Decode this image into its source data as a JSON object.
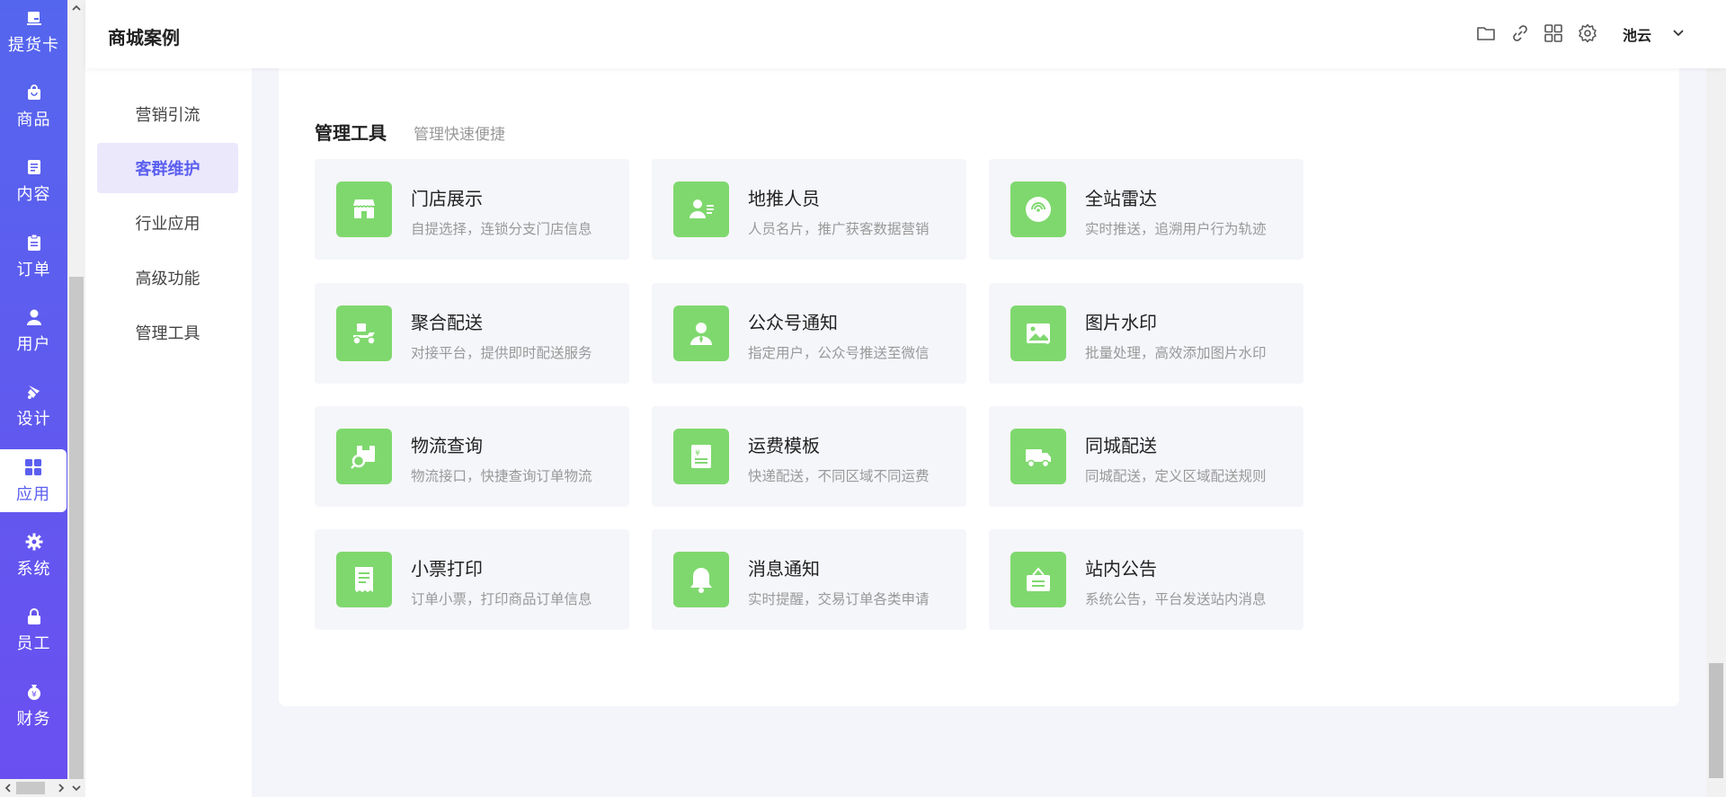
{
  "nav": {
    "items": [
      {
        "label": "提货卡",
        "icon": "card-icon"
      },
      {
        "label": "商品",
        "icon": "bag-icon"
      },
      {
        "label": "内容",
        "icon": "document-icon"
      },
      {
        "label": "订单",
        "icon": "clipboard-icon"
      },
      {
        "label": "用户",
        "icon": "user-icon"
      },
      {
        "label": "设计",
        "icon": "brush-icon"
      },
      {
        "label": "应用",
        "icon": "apps-grid-icon",
        "active": true
      },
      {
        "label": "系统",
        "icon": "gear-icon"
      },
      {
        "label": "员工",
        "icon": "lock-icon"
      },
      {
        "label": "财务",
        "icon": "money-bag-icon"
      }
    ]
  },
  "header": {
    "title": "商城案例",
    "icons": [
      "folder-icon",
      "link-icon",
      "grid-icon",
      "settings-icon"
    ],
    "avatar_text": "池云"
  },
  "sub_sidebar": {
    "items": [
      {
        "label": "营销引流"
      },
      {
        "label": "客群维护",
        "active": true
      },
      {
        "label": "行业应用"
      },
      {
        "label": "高级功能"
      },
      {
        "label": "管理工具"
      }
    ]
  },
  "section": {
    "title": "管理工具",
    "subtitle": "管理快速便捷",
    "tools": [
      {
        "name": "门店展示",
        "desc": "自提选择，连锁分支门店信息",
        "icon": "store-icon"
      },
      {
        "name": "地推人员",
        "desc": "人员名片，推广获客数据营销",
        "icon": "staff-card-icon"
      },
      {
        "name": "全站雷达",
        "desc": "实时推送，追溯用户行为轨迹",
        "icon": "radar-icon"
      },
      {
        "name": "聚合配送",
        "desc": "对接平台，提供即时配送服务",
        "icon": "scooter-icon"
      },
      {
        "name": "公众号通知",
        "desc": "指定用户，公众号推送至微信",
        "icon": "person-icon"
      },
      {
        "name": "图片水印",
        "desc": "批量处理，高效添加图片水印",
        "icon": "image-icon"
      },
      {
        "name": "物流查询",
        "desc": "物流接口，快捷查询订单物流",
        "icon": "package-search-icon"
      },
      {
        "name": "运费模板",
        "desc": "快递配送，不同区域不同运费",
        "icon": "freight-doc-icon"
      },
      {
        "name": "同城配送",
        "desc": "同城配送，定义区域配送规则",
        "icon": "truck-icon"
      },
      {
        "name": "小票打印",
        "desc": "订单小票，打印商品订单信息",
        "icon": "receipt-icon"
      },
      {
        "name": "消息通知",
        "desc": "实时提醒，交易订单各类申请",
        "icon": "bell-icon"
      },
      {
        "name": "站内公告",
        "desc": "系统公告，平台发送站内消息",
        "icon": "notice-board-icon"
      }
    ]
  },
  "colors": {
    "nav_gradient_top": "#5566ee",
    "nav_gradient_bottom": "#6a4ff0",
    "accent": "#5b5fef",
    "tile_icon_bg": "#7fd86e",
    "tile_bg": "#f5f6fa"
  }
}
